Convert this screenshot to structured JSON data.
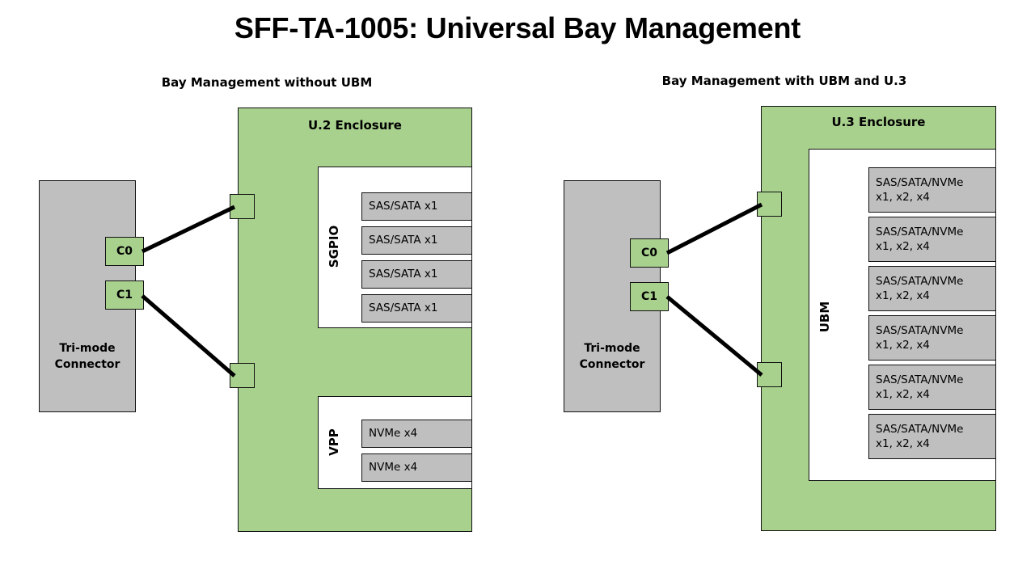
{
  "page": {
    "title": "SFF-TA-1005: Universal Bay Management",
    "background_color": "#ffffff"
  },
  "colors": {
    "enclosure_green": "#a9d18e",
    "drive_gray": "#bfbfbf",
    "outline": "#111111",
    "cable": "#000000"
  },
  "left_panel": {
    "subtitle": "Bay Management without UBM",
    "host": {
      "label_line1": "Tri-mode",
      "label_line2": "Connector",
      "ports": [
        {
          "name": "C0"
        },
        {
          "name": "C1"
        }
      ]
    },
    "enclosure": {
      "title": "U.2 Enclosure",
      "groups": [
        {
          "label": "SGPIO",
          "drives": [
            {
              "line1": "SAS/SATA x1"
            },
            {
              "line1": "SAS/SATA x1"
            },
            {
              "line1": "SAS/SATA x1"
            },
            {
              "line1": "SAS/SATA x1"
            }
          ]
        },
        {
          "label": "VPP",
          "drives": [
            {
              "line1": "NVMe x4"
            },
            {
              "line1": "NVMe x4"
            }
          ]
        }
      ]
    }
  },
  "right_panel": {
    "subtitle": "Bay Management with UBM and U.3",
    "host": {
      "label_line1": "Tri-mode",
      "label_line2": "Connector",
      "ports": [
        {
          "name": "C0"
        },
        {
          "name": "C1"
        }
      ]
    },
    "enclosure": {
      "title": "U.3 Enclosure",
      "groups": [
        {
          "label": "UBM",
          "drives": [
            {
              "line1": "SAS/SATA/NVMe",
              "line2": "x1, x2, x4"
            },
            {
              "line1": "SAS/SATA/NVMe",
              "line2": "x1, x2, x4"
            },
            {
              "line1": "SAS/SATA/NVMe",
              "line2": "x1, x2, x4"
            },
            {
              "line1": "SAS/SATA/NVMe",
              "line2": "x1, x2, x4"
            },
            {
              "line1": "SAS/SATA/NVMe",
              "line2": "x1, x2, x4"
            },
            {
              "line1": "SAS/SATA/NVMe",
              "line2": "x1, x2, x4"
            }
          ]
        }
      ]
    }
  }
}
